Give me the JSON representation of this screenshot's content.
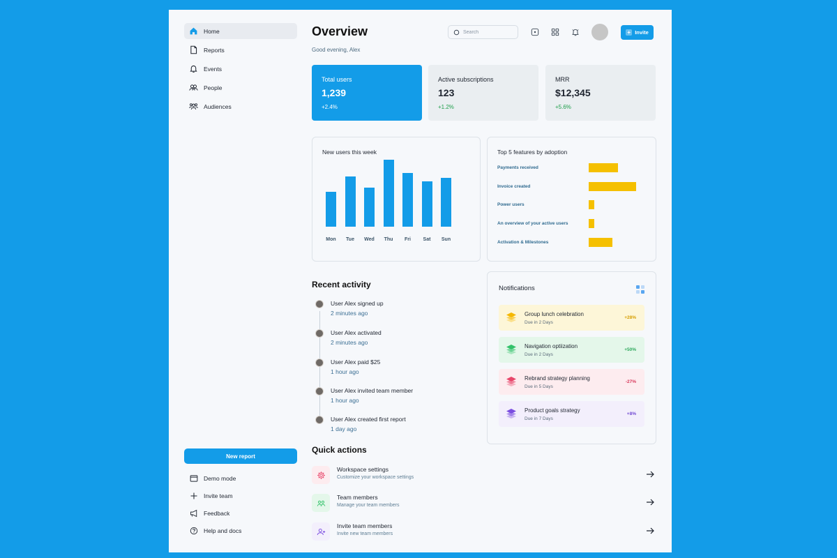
{
  "sidebar": {
    "items": [
      {
        "label": "Home",
        "icon": "home-icon",
        "active": true
      },
      {
        "label": "Reports",
        "icon": "document-icon",
        "active": false
      },
      {
        "label": "Events",
        "icon": "bell-icon",
        "active": false
      },
      {
        "label": "People",
        "icon": "people-icon",
        "active": false
      },
      {
        "label": "Audiences",
        "icon": "audiences-icon",
        "active": false
      }
    ],
    "new_report_label": "New report",
    "bottom": [
      {
        "label": "Demo mode",
        "icon": "window-icon"
      },
      {
        "label": "Invite team",
        "icon": "plus-icon"
      },
      {
        "label": "Feedback",
        "icon": "megaphone-icon"
      },
      {
        "label": "Help and docs",
        "icon": "help-icon"
      }
    ]
  },
  "header": {
    "title": "Overview",
    "subtitle": "Good evening, Alex",
    "search_placeholder": "Search",
    "invite_label": "Invite"
  },
  "stats": [
    {
      "label": "Total users",
      "value": "1,239",
      "change": "+2.4%"
    },
    {
      "label": "Active subscriptions",
      "value": "123",
      "change": "+1.2%"
    },
    {
      "label": "MRR",
      "value": "$12,345",
      "change": "+5.6%"
    }
  ],
  "new_users_chart": {
    "title": "New users this week"
  },
  "features_chart": {
    "title": "Top 5 features by adoption"
  },
  "chart_data": [
    {
      "type": "bar",
      "title": "New users this week",
      "categories": [
        "Mon",
        "Tue",
        "Wed",
        "Thu",
        "Fri",
        "Sat",
        "Sun"
      ],
      "values": [
        40,
        58,
        45,
        77,
        62,
        52,
        56
      ],
      "ylim": [
        0,
        80
      ],
      "grid": false,
      "color": "#139ce8"
    },
    {
      "type": "bar",
      "orientation": "horizontal",
      "title": "Top 5 features by adoption",
      "categories": [
        "Payments received",
        "Invoice created",
        "Power users",
        "An overview of your active users",
        "Activation & Milestones"
      ],
      "values": [
        42,
        68,
        8,
        8,
        34
      ],
      "ylim": [
        0,
        100
      ],
      "grid": false,
      "color": "#f5c000"
    }
  ],
  "recent_activity": {
    "title": "Recent activity",
    "items": [
      {
        "title": "User Alex signed up",
        "time": "2 minutes ago"
      },
      {
        "title": "User Alex activated",
        "time": "2 minutes ago"
      },
      {
        "title": "User Alex paid $25",
        "time": "1 hour ago"
      },
      {
        "title": "User Alex invited team member",
        "time": "1 hour ago"
      },
      {
        "title": "User Alex created first report",
        "time": "1 day ago"
      }
    ]
  },
  "notifications": {
    "title": "Notifications",
    "items": [
      {
        "title": "Group lunch celebration",
        "due": "Due in 2 Days",
        "pct": "+28%",
        "bg": "#fdf6d8",
        "color": "#f5b800",
        "pct_color": "#d69e00"
      },
      {
        "title": "Navigation optiization",
        "due": "Due in 2 Days",
        "pct": "+50%",
        "bg": "#e4f7ea",
        "color": "#34c26b",
        "pct_color": "#2da85c"
      },
      {
        "title": "Rebrand strategy planning",
        "due": "Due in 5 Days",
        "pct": "-27%",
        "bg": "#fdecef",
        "color": "#e8466a",
        "pct_color": "#d8375a"
      },
      {
        "title": "Product goals strategy",
        "due": "Due in 7 Days",
        "pct": "+8%",
        "bg": "#f3effc",
        "color": "#7b4ee0",
        "pct_color": "#7048d2"
      }
    ]
  },
  "quick_actions": {
    "title": "Quick actions",
    "items": [
      {
        "title": "Workspace settings",
        "desc": "Customize your workspace settings",
        "icon": "gear-icon",
        "bg": "#fdecef",
        "color": "#e8466a"
      },
      {
        "title": "Team members",
        "desc": "Manage your team members",
        "icon": "team-icon",
        "bg": "#e4f7ea",
        "color": "#34c26b"
      },
      {
        "title": "Invite team members",
        "desc": "Invite new team members",
        "icon": "add-user-icon",
        "bg": "#f3effc",
        "color": "#7b4ee0"
      }
    ]
  },
  "colors": {
    "brand": "#139ce8",
    "background": "#139ce8",
    "panel": "#f6f8fb",
    "positive": "#1e9e4a",
    "feature_bar": "#f5c000"
  }
}
